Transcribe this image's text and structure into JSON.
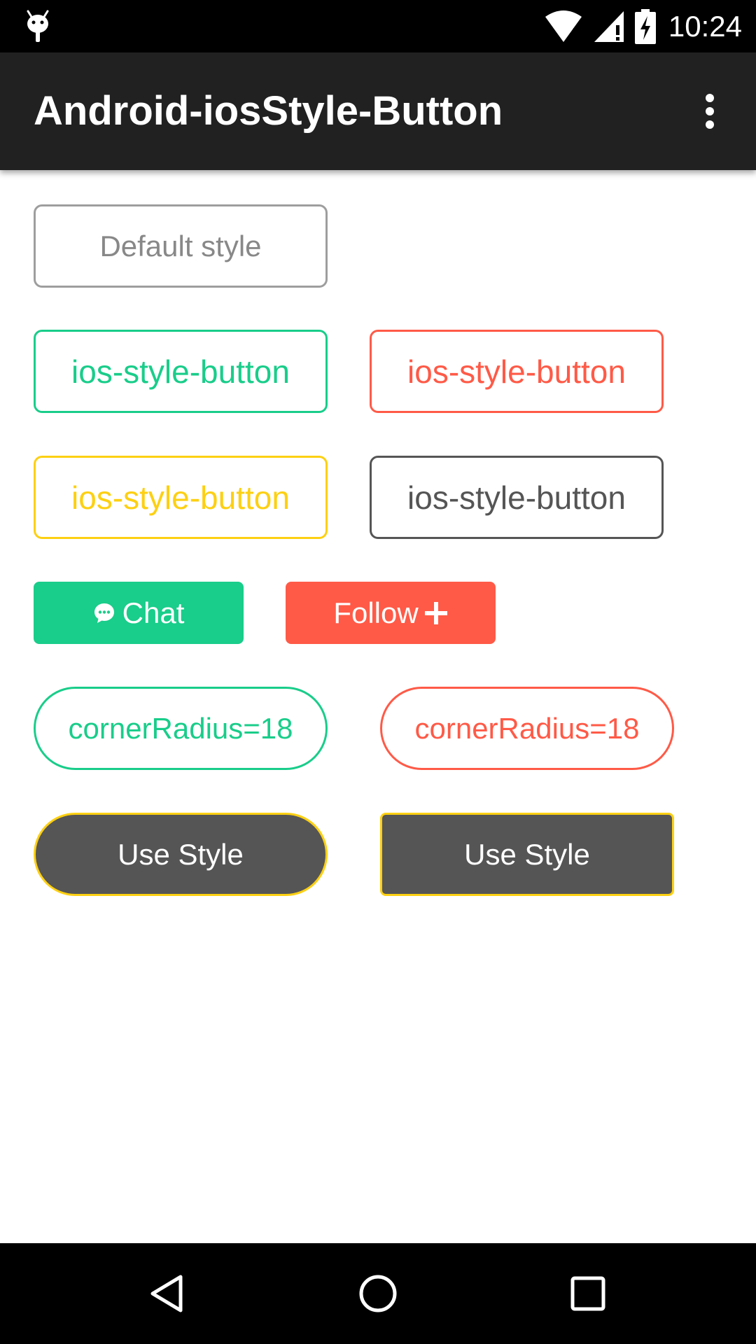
{
  "status_bar": {
    "time": "10:24",
    "icons": [
      "android-debug-icon",
      "wifi-icon",
      "signal-icon",
      "battery-charging-icon"
    ]
  },
  "app_bar": {
    "title": "Android-iosStyle-Button",
    "menu_icon": "more-vert-icon"
  },
  "buttons": {
    "default_style": "Default style",
    "ios_green": "ios-style-button",
    "ios_red": "ios-style-button",
    "ios_yellow": "ios-style-button",
    "ios_gray": "ios-style-button",
    "chat": "Chat",
    "follow": "Follow",
    "corner_green": "cornerRadius=18",
    "corner_red": "cornerRadius=18",
    "use_style_round": "Use Style",
    "use_style_square": "Use Style"
  },
  "colors": {
    "green": "#19cd8a",
    "red": "#ff5a47",
    "yellow": "#fdd012",
    "gray": "#555555",
    "default_border": "#9e9e9e",
    "default_text": "#888888"
  },
  "nav_bar": {
    "icons": [
      "back-icon",
      "home-icon",
      "recents-icon"
    ]
  }
}
